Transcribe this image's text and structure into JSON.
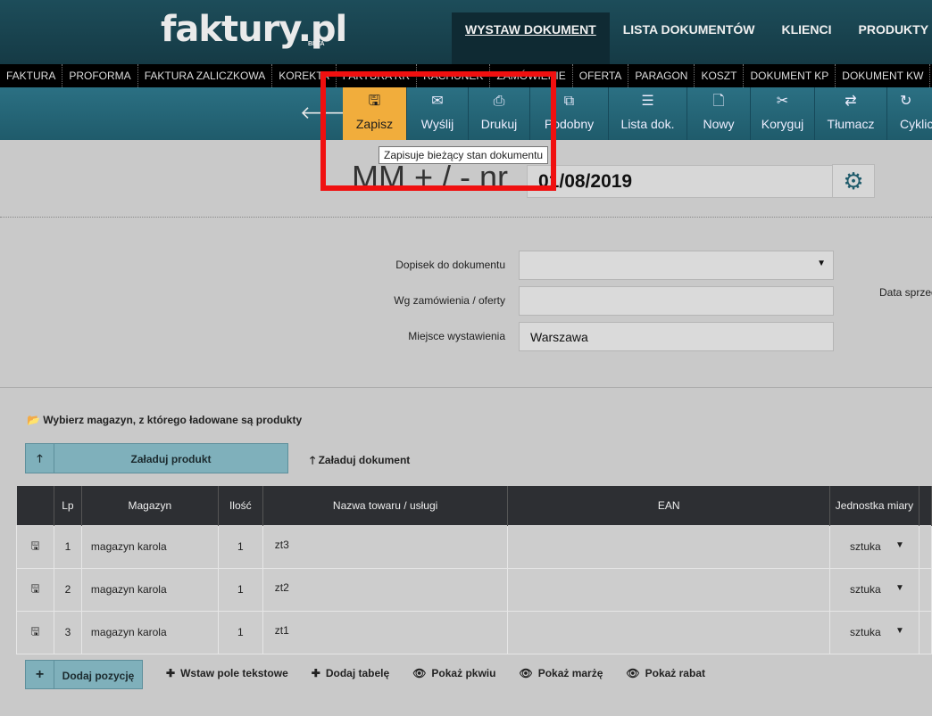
{
  "logo": {
    "text": "faktury.pl",
    "beta": "BETA"
  },
  "main_nav": [
    "WYSTAW DOKUMENT",
    "LISTA DOKUMENTÓW",
    "KLIENCI",
    "PRODUKTY"
  ],
  "doc_types": [
    "FAKTURA",
    "PROFORMA",
    "FAKTURA ZALICZKOWA",
    "KOREKTA",
    "FAKTURA RR",
    "RACHUNEK",
    "ZAMÓWIENIE",
    "OFERTA",
    "PARAGON",
    "KOSZT",
    "DOKUMENT KP",
    "DOKUMENT KW"
  ],
  "toolbar": {
    "items": [
      {
        "label": "Zapisz",
        "icon": "floppy-icon",
        "glyph": "🖫"
      },
      {
        "label": "Wyślij",
        "icon": "envelope-icon",
        "glyph": "✉"
      },
      {
        "label": "Drukuj",
        "icon": "printer-icon",
        "glyph": "⎙"
      },
      {
        "label": "Podobny",
        "icon": "copy-icon",
        "glyph": "⧉"
      },
      {
        "label": "Lista dok.",
        "icon": "list-icon",
        "glyph": "☰"
      },
      {
        "label": "Nowy",
        "icon": "file-icon",
        "glyph": "🗋"
      },
      {
        "label": "Koryguj",
        "icon": "tools-icon",
        "glyph": "✂"
      },
      {
        "label": "Tłumacz",
        "icon": "exchange-icon",
        "glyph": "⇄"
      },
      {
        "label": "Cyklicz",
        "icon": "cycle-icon",
        "glyph": "↻"
      }
    ],
    "tooltip": "Zapisuje bieżący stan dokumentu"
  },
  "document": {
    "title": "MM + / - nr",
    "date": "01/08/2019"
  },
  "form": {
    "note_label": "Dopisek do dokumentu",
    "note_value": "",
    "order_label": "Wg zamówienia / oferty",
    "order_value": "",
    "place_label": "Miejsce wystawienia",
    "place_value": "Warszawa",
    "sale_date_label": "Data sprzedaży"
  },
  "warehouse": {
    "prompt": "Wybierz magazyn, z którego ładowane są produkty",
    "load_product": "Załaduj produkt",
    "load_document": "Załaduj dokument"
  },
  "table": {
    "headers": {
      "lp": "Lp",
      "magazyn": "Magazyn",
      "ilosc": "Ilość",
      "nazwa": "Nazwa towaru / usługi",
      "ean": "EAN",
      "jm": "Jednostka miary"
    },
    "rows": [
      {
        "lp": "1",
        "magazyn": "magazyn karola",
        "ilosc": "1",
        "nazwa": "zt3",
        "ean": "",
        "jm": "sztuka"
      },
      {
        "lp": "2",
        "magazyn": "magazyn karola",
        "ilosc": "1",
        "nazwa": "zt2",
        "ean": "",
        "jm": "sztuka"
      },
      {
        "lp": "3",
        "magazyn": "magazyn karola",
        "ilosc": "1",
        "nazwa": "zt1",
        "ean": "",
        "jm": "sztuka"
      }
    ]
  },
  "actions": {
    "add_position": "Dodaj pozycję",
    "insert_text": "Wstaw pole tekstowe",
    "add_table": "Dodaj tabelę",
    "show_pkwiu": "Pokaż pkwiu",
    "show_margin": "Pokaż marżę",
    "show_discount": "Pokaż rabat"
  },
  "colors": {
    "header": "#1d4d5a",
    "toolbar": "#2b7083",
    "active_tool": "#f1ad3c",
    "highlight": "#f01010"
  }
}
